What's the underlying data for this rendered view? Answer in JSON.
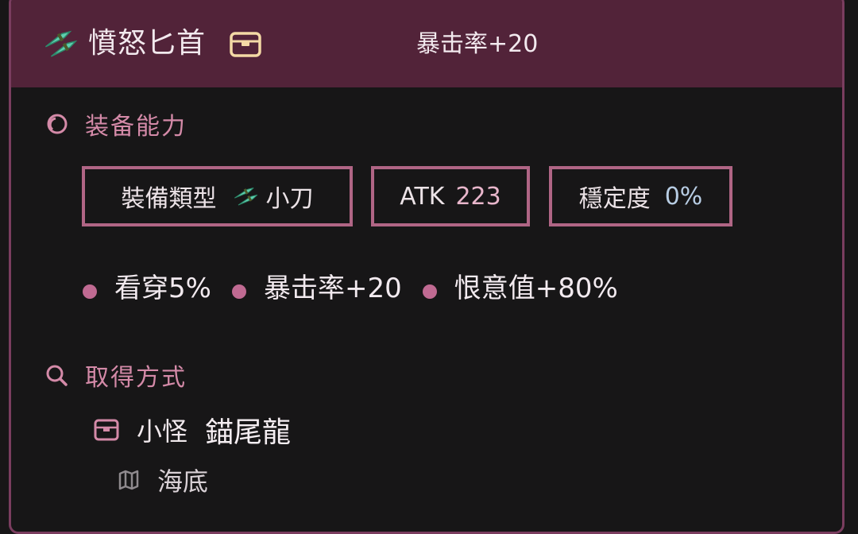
{
  "item": {
    "name": "憤怒匕首",
    "header_stat": "暴击率+20"
  },
  "equipment": {
    "section_label": "装备能力",
    "type_label": "裝備類型",
    "type_value": "小刀",
    "atk_label": "ATK",
    "atk_value": "223",
    "stability_label": "穩定度",
    "stability_value": "0%",
    "stats": [
      "看穿5%",
      "暴击率+20",
      "恨意值+80%"
    ]
  },
  "acquire": {
    "section_label": "取得方式",
    "source_type": "小怪",
    "source_name": "錨尾龍",
    "location": "海底"
  },
  "icons": {
    "weapon": "dagger-icon",
    "chest": "chest-icon",
    "ability": "ring-icon",
    "search": "search-icon",
    "map": "map-icon"
  },
  "colors": {
    "header_bg": "#522339",
    "accent": "#b06585",
    "label_pink": "#d48aa8",
    "dot": "#c06a92",
    "chest_gold": "#f4d9a6"
  }
}
